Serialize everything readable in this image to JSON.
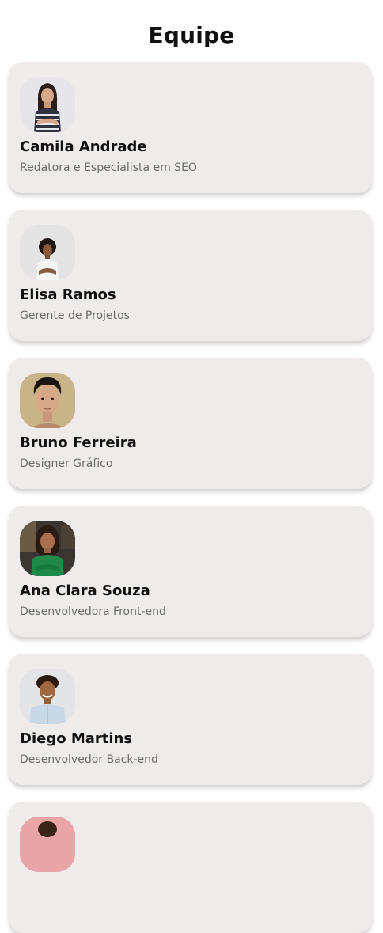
{
  "page": {
    "title": "Equipe"
  },
  "team": [
    {
      "name": "Camila Andrade",
      "role": "Redatora e Especialista em SEO",
      "avatar_bg": "#e6e6ea"
    },
    {
      "name": "Elisa Ramos",
      "role": "Gerente de Projetos",
      "avatar_bg": "#e4e4e4"
    },
    {
      "name": "Bruno Ferreira",
      "role": "Designer Gráfico",
      "avatar_bg": "#c9b48a"
    },
    {
      "name": "Ana Clara Souza",
      "role": "Desenvolvedora Front-end",
      "avatar_bg": "#3a3530"
    },
    {
      "name": "Diego Martins",
      "role": "Desenvolvedor Back-end",
      "avatar_bg": "#e2e4e6"
    },
    {
      "name": "",
      "role": "",
      "avatar_bg": "#e9a4a8"
    }
  ]
}
